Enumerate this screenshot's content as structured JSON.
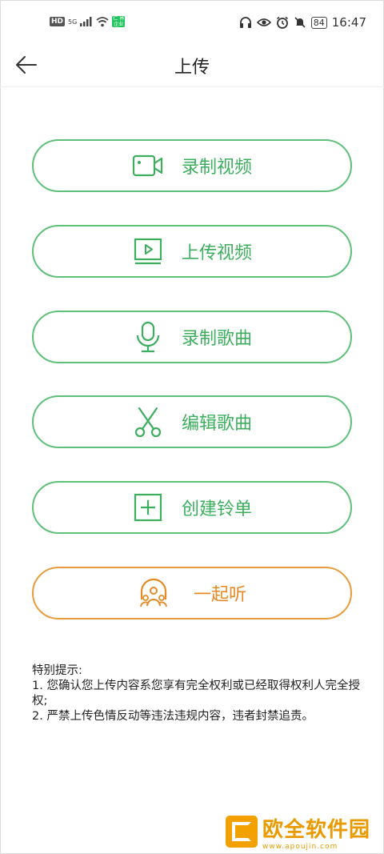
{
  "status_bar": {
    "hd": "HD",
    "network": "5G",
    "wechat_badge": "仁 界 企业",
    "battery": "84",
    "time": "16:47"
  },
  "header": {
    "title": "上传"
  },
  "buttons": [
    {
      "label": "录制视频",
      "icon": "video-camera-icon"
    },
    {
      "label": "上传视频",
      "icon": "play-screen-icon"
    },
    {
      "label": "录制歌曲",
      "icon": "microphone-icon"
    },
    {
      "label": "编辑歌曲",
      "icon": "scissors-icon"
    },
    {
      "label": "创建铃单",
      "icon": "add-box-icon"
    },
    {
      "label": "一起听",
      "icon": "listen-together-icon"
    }
  ],
  "notice": {
    "heading": "特别提示:",
    "line1": "1. 您确认您上传内容系您享有完全权利或已经取得权利人完全授权;",
    "line2": "2. 严禁上传色情反动等违法违规内容，违者封禁追责。"
  },
  "watermark": {
    "name": "欧全软件园",
    "url": "www.apoujin.com"
  },
  "colors": {
    "green": "#5fc07a",
    "green_text": "#3cae5e",
    "orange": "#e99c3e"
  }
}
